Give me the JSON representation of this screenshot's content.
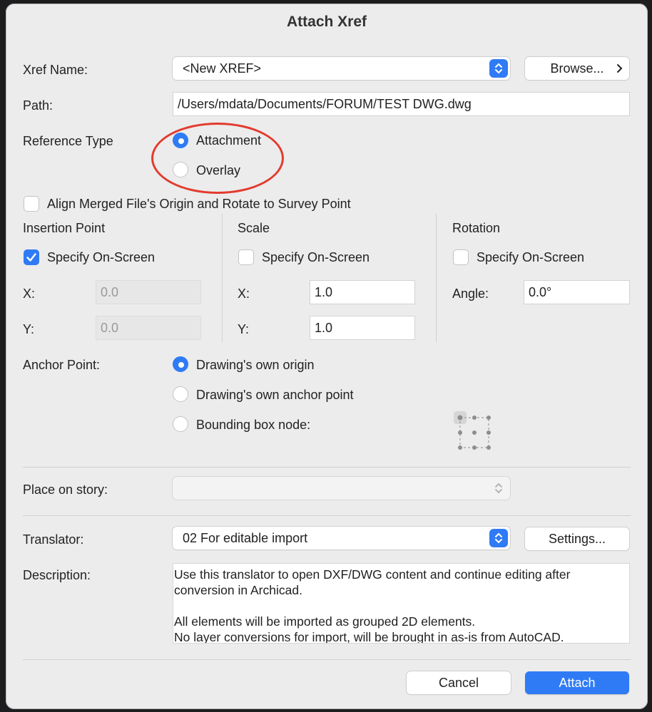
{
  "dialog": {
    "title": "Attach Xref"
  },
  "xref": {
    "label": "Xref Name:",
    "value": "<New XREF>",
    "browse": "Browse..."
  },
  "path": {
    "label": "Path:",
    "value": "/Users/mdata/Documents/FORUM/TEST DWG.dwg"
  },
  "reference_type": {
    "label": "Reference Type",
    "options": [
      "Attachment",
      "Overlay"
    ],
    "selected": "Attachment"
  },
  "align": {
    "label": "Align Merged File's Origin and Rotate to Survey Point",
    "checked": false
  },
  "insertion": {
    "title": "Insertion Point",
    "specify": "Specify On-Screen",
    "specify_checked": true,
    "x_label": "X:",
    "x_value": "0.0",
    "y_label": "Y:",
    "y_value": "0.0"
  },
  "scale": {
    "title": "Scale",
    "specify": "Specify On-Screen",
    "specify_checked": false,
    "x_label": "X:",
    "x_value": "1.0",
    "y_label": "Y:",
    "y_value": "1.0"
  },
  "rotation": {
    "title": "Rotation",
    "specify": "Specify On-Screen",
    "specify_checked": false,
    "angle_label": "Angle:",
    "angle_value": "0.0°"
  },
  "anchor": {
    "label": "Anchor Point:",
    "options": [
      "Drawing's own origin",
      "Drawing's own anchor point",
      "Bounding box node:"
    ],
    "selected": "Drawing's own origin"
  },
  "story": {
    "label": "Place on story:",
    "value": ""
  },
  "translator": {
    "label": "Translator:",
    "value": "02 For editable import",
    "settings": "Settings..."
  },
  "description": {
    "label": "Description:",
    "line1": "Use this translator to open DXF/DWG content and continue editing after",
    "line2": "conversion in Archicad.",
    "line3": "All elements will be imported as grouped 2D elements.",
    "line4": "No layer conversions for import, will be brought in as-is from AutoCAD."
  },
  "footer": {
    "cancel": "Cancel",
    "attach": "Attach"
  },
  "colors": {
    "accent": "#2f7bf5",
    "highlight_circle": "#e23b2e"
  }
}
